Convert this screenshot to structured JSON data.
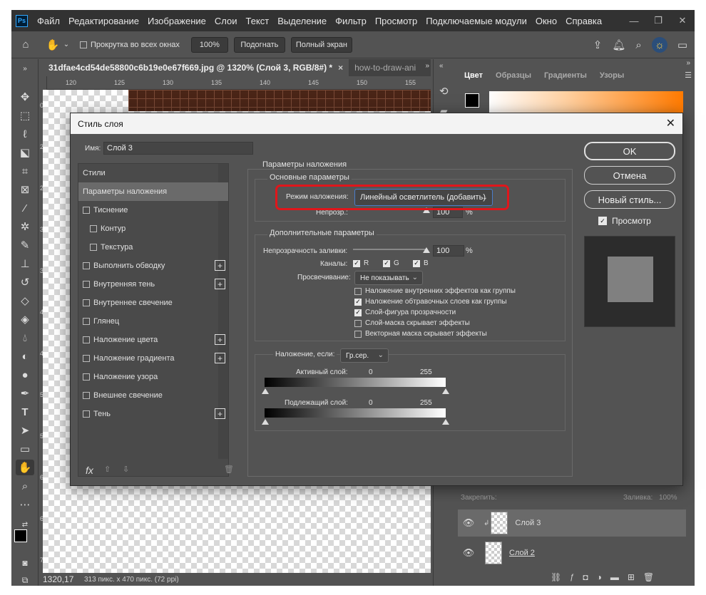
{
  "app": {
    "logo": "Ps",
    "menu": [
      "Файл",
      "Редактирование",
      "Изображение",
      "Слои",
      "Текст",
      "Выделение",
      "Фильтр",
      "Просмотр",
      "Подключаемые модули",
      "Окно",
      "Справка"
    ],
    "window_controls": [
      "—",
      "❐",
      "✕"
    ]
  },
  "options_bar": {
    "scroll_all_label": "Прокрутка во всех окнах",
    "zoom_btn": "100%",
    "fit_btn": "Подогнать",
    "fullscreen_btn": "Полный экран"
  },
  "tabs": [
    {
      "label": "31dfae4cd54de58800c6b19e0e67f669.jpg @ 1320% (Слой 3, RGB/8#) *",
      "close": "×"
    },
    {
      "label": "how-to-draw-ani"
    }
  ],
  "ruler": {
    "top": [
      "120",
      "125",
      "130",
      "135",
      "140",
      "145",
      "150",
      "155"
    ],
    "left": [
      "0",
      "2",
      "2",
      "3",
      "3",
      "4",
      "4",
      "5",
      "5",
      "6",
      "6",
      "7"
    ]
  },
  "status": {
    "zoom": "1320,17",
    "doc": "313 пикс. x 470 пикс. (72 ppi)"
  },
  "panel_tabs": [
    "Цвет",
    "Образцы",
    "Градиенты",
    "Узоры"
  ],
  "layers_panel": {
    "lock_label": "Закрепить:",
    "fill_label": "Заливка:",
    "fill_value": "100%",
    "layers": [
      {
        "name": "Слой 3"
      },
      {
        "name": "Слой 2"
      }
    ]
  },
  "dialog": {
    "title": "Стиль слоя",
    "name_label": "Имя:",
    "name_value": "Слой 3",
    "styles": [
      {
        "label": "Стили",
        "checkbox": false,
        "indent": false,
        "plus": false,
        "active": false
      },
      {
        "label": "Параметры наложения",
        "checkbox": false,
        "indent": false,
        "plus": false,
        "active": true
      },
      {
        "label": "Тиснение",
        "checkbox": true,
        "indent": false,
        "plus": false,
        "active": false
      },
      {
        "label": "Контур",
        "checkbox": true,
        "indent": true,
        "plus": false,
        "active": false
      },
      {
        "label": "Текстура",
        "checkbox": true,
        "indent": true,
        "plus": false,
        "active": false
      },
      {
        "label": "Выполнить обводку",
        "checkbox": true,
        "indent": false,
        "plus": true,
        "active": false
      },
      {
        "label": "Внутренняя тень",
        "checkbox": true,
        "indent": false,
        "plus": true,
        "active": false
      },
      {
        "label": "Внутреннее свечение",
        "checkbox": true,
        "indent": false,
        "plus": false,
        "active": false
      },
      {
        "label": "Глянец",
        "checkbox": true,
        "indent": false,
        "plus": false,
        "active": false
      },
      {
        "label": "Наложение цвета",
        "checkbox": true,
        "indent": false,
        "plus": true,
        "active": false
      },
      {
        "label": "Наложение градиента",
        "checkbox": true,
        "indent": false,
        "plus": true,
        "active": false
      },
      {
        "label": "Наложение узора",
        "checkbox": true,
        "indent": false,
        "plus": false,
        "active": false
      },
      {
        "label": "Внешнее свечение",
        "checkbox": true,
        "indent": false,
        "plus": false,
        "active": false
      },
      {
        "label": "Тень",
        "checkbox": true,
        "indent": false,
        "plus": true,
        "active": false
      }
    ],
    "blend_section_title": "Параметры наложения",
    "basic_title": "Основные параметры",
    "blend_mode_label": "Режим наложения:",
    "blend_mode_value": "Линейный осветлитель (добавить)",
    "opacity_label": "Непрозр.:",
    "opacity_value": "100",
    "percent": "%",
    "advanced_title": "Дополнительные параметры",
    "fill_opacity_label": "Непрозрачность заливки:",
    "fill_opacity_value": "100",
    "channels_label": "Каналы:",
    "channels": [
      "R",
      "G",
      "B"
    ],
    "knockout_label": "Просвечивание:",
    "knockout_value": "Не показывать",
    "options": [
      {
        "label": "Наложение внутренних эффектов как группы",
        "checked": false
      },
      {
        "label": "Наложение обтравочных слоев как группы",
        "checked": true
      },
      {
        "label": "Слой-фигура прозрачности",
        "checked": true
      },
      {
        "label": "Слой-маска скрывает эффекты",
        "checked": false
      },
      {
        "label": "Векторная маска скрывает эффекты",
        "checked": false
      }
    ],
    "blend_if_label": "Наложение, если:",
    "blend_if_value": "Гр.сер.",
    "this_layer_label": "Активный слой:",
    "underlying_label": "Подлежащий слой:",
    "range_min": "0",
    "range_max": "255",
    "ok": "OK",
    "cancel": "Отмена",
    "new_style": "Новый стиль...",
    "preview_label": "Просмотр",
    "fx": "fx"
  }
}
